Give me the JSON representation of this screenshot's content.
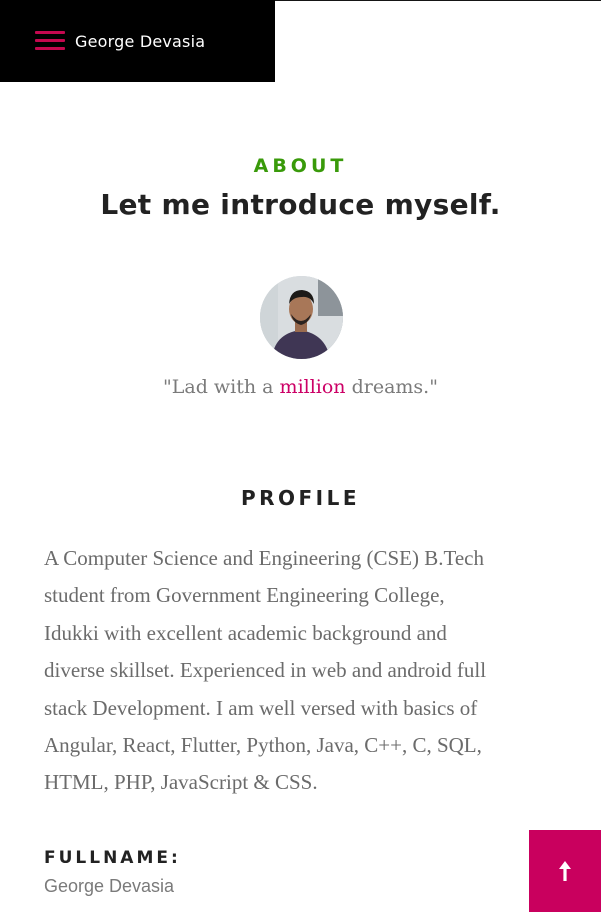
{
  "header": {
    "brand": "George Devasia",
    "menu_icon": "hamburger-menu-icon"
  },
  "about": {
    "eyebrow": "ABOUT",
    "title": "Let me introduce myself.",
    "quote_before": "\"Lad with a ",
    "quote_highlight": "million",
    "quote_after": " dreams.\""
  },
  "profile": {
    "title": "PROFILE",
    "lines": [
      "A Computer Science and Engineering (CSE) B.Tech",
      "student from Government Engineering College,",
      "Idukki with excellent academic background and",
      "diverse skillset. Experienced in web and android full",
      "stack Development. I am well versed with basics of",
      "Angular, React, Flutter, Python, Java, C++, C, SQL,",
      "HTML, PHP, JavaScript & CSS."
    ],
    "fullname_label": "FULLNAME:",
    "fullname_value": "George Devasia"
  },
  "scroll_top": {
    "icon": "arrow-up-icon"
  },
  "colors": {
    "accent_pink": "#c9005e",
    "accent_green": "#399a0a",
    "header_bg": "#000000"
  }
}
